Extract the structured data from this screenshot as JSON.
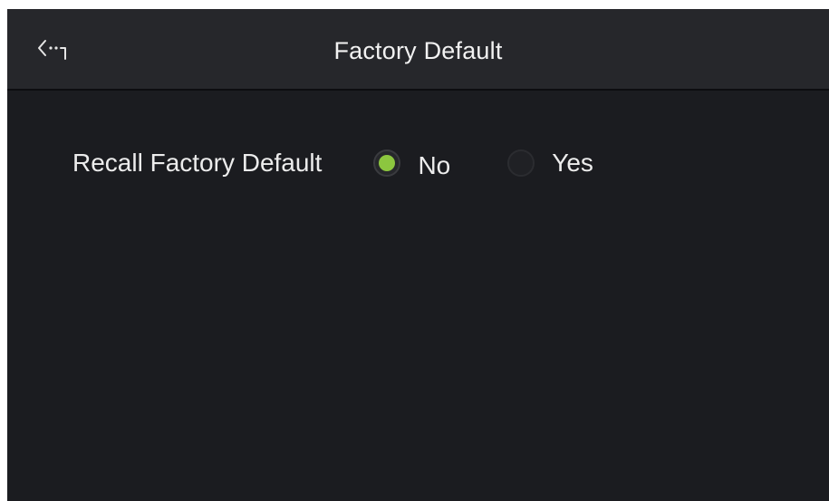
{
  "header": {
    "title": "Factory Default",
    "back_icon": "back-exit-icon"
  },
  "setting": {
    "label": "Recall Factory Default",
    "options": [
      {
        "label": "No",
        "selected": true
      },
      {
        "label": "Yes",
        "selected": false
      }
    ]
  },
  "colors": {
    "background": "#1b1c20",
    "header_background": "#26272b",
    "accent": "#8cc63f",
    "text": "#ececec"
  }
}
